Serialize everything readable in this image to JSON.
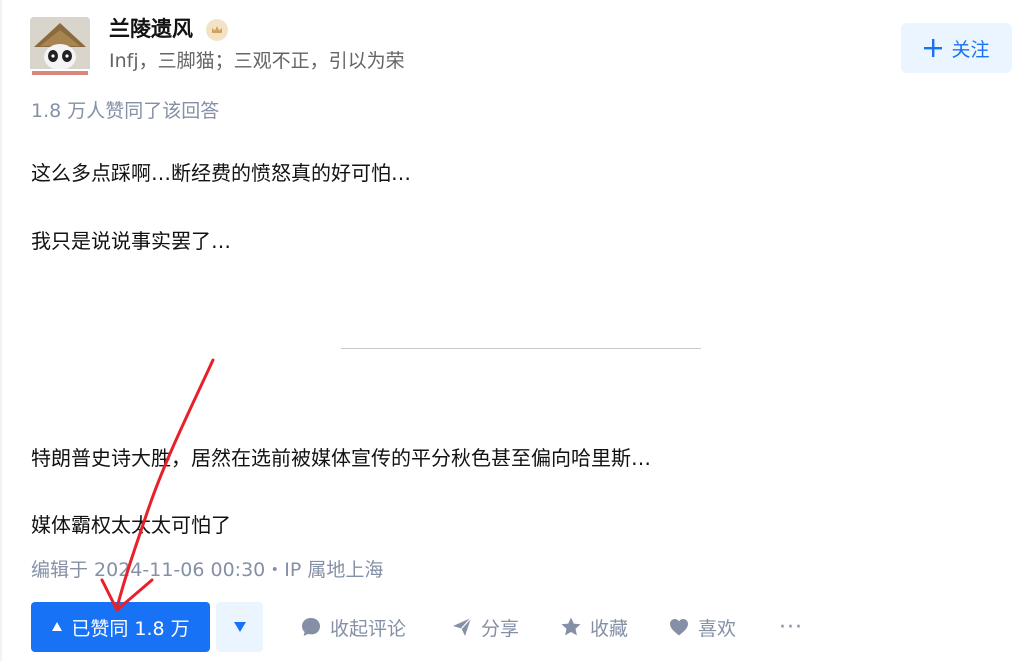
{
  "author": {
    "name": "兰陵遗风",
    "bio": "Infj，三脚猫；三观不正，引以为荣",
    "follow_label": "关注"
  },
  "answer": {
    "vote_summary": "1.8 万人赞同了该回答",
    "paragraphs": [
      "这么多点踩啊…断经费的愤怒真的好可怕…",
      "我只是说说事实罢了…",
      "特朗普史诗大胜，居然在选前被媒体宣传的平分秋色甚至偏向哈里斯…",
      "媒体霸权太太太可怕了"
    ],
    "edit_info": "编辑于 2024-11-06 00:30・IP 属地上海"
  },
  "actions": {
    "upvote_label": "已赞同 1.8 万",
    "comment_label": "收起评论",
    "share_label": "分享",
    "collect_label": "收藏",
    "like_label": "喜欢",
    "more_label": "···"
  },
  "colors": {
    "accent": "#1772f6",
    "accent_light": "#ebf5ff",
    "muted": "#8590a6",
    "annotation_arrow": "#e8202a"
  }
}
